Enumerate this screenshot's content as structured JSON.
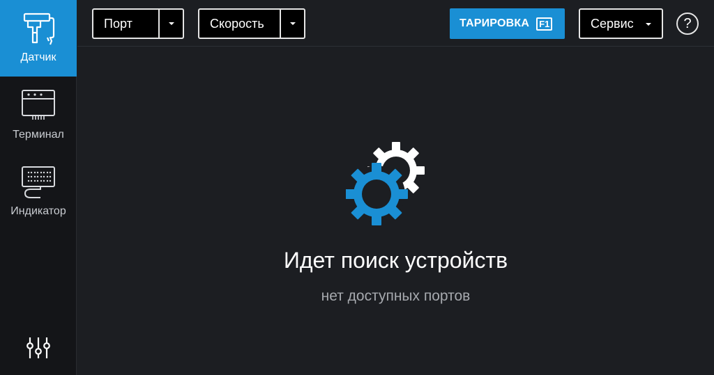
{
  "sidebar": {
    "items": [
      {
        "label": "Датчик",
        "icon": "sensor-icon",
        "active": true
      },
      {
        "label": "Терминал",
        "icon": "terminal-icon",
        "active": false
      },
      {
        "label": "Индикатор",
        "icon": "indicator-icon",
        "active": false
      }
    ],
    "settings_icon": "sliders-icon"
  },
  "toolbar": {
    "port_label": "Порт",
    "speed_label": "Скорость",
    "calibration_label": "ТАРИРОВКА",
    "calibration_key": "F1",
    "service_label": "Сервис",
    "help_label": "?"
  },
  "main": {
    "title": "Идет поиск устройств",
    "subtitle": "нет доступных портов",
    "icon": "gears-icon"
  },
  "colors": {
    "accent": "#1a8fd4",
    "background": "#1c1e22",
    "sidebar": "#141518"
  }
}
